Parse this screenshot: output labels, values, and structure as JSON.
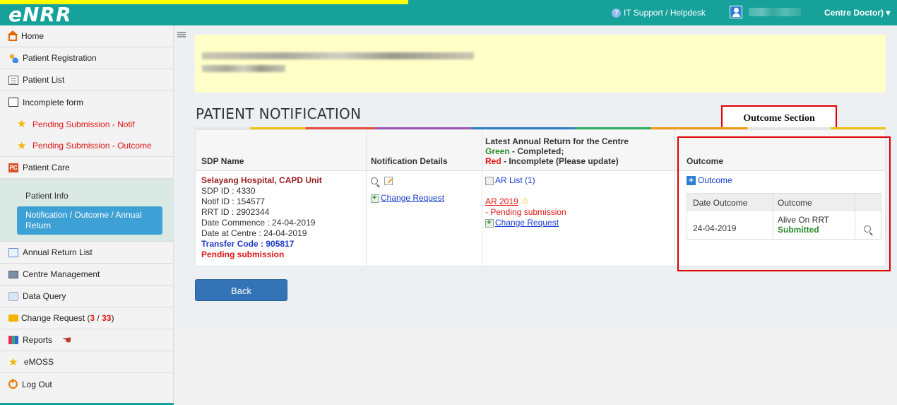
{
  "app": {
    "logo": "eNRR"
  },
  "header": {
    "helpdesk": "IT Support / Helpdesk",
    "user_role": "Centre Doctor)"
  },
  "sidebar": {
    "items": [
      {
        "label": "Home",
        "icon": "home-icon"
      },
      {
        "label": "Patient Registration",
        "icon": "people-icon"
      },
      {
        "label": "Patient List",
        "icon": "list-icon"
      },
      {
        "label": "Incomplete form",
        "icon": "form-icon"
      },
      {
        "label": "Pending Submission - Notif",
        "icon": "star-icon"
      },
      {
        "label": "Pending Submission - Outcome",
        "icon": "star-icon"
      },
      {
        "label": "Patient Care",
        "icon": "pc-icon"
      }
    ],
    "patient_care_sub": {
      "patient_info": "Patient Info",
      "active": "Notification / Outcome / Annual Return"
    },
    "items2": [
      {
        "label": "Annual Return List",
        "icon": "document-icon"
      },
      {
        "label": "Centre Management",
        "icon": "monitor-icon"
      },
      {
        "label": "Data Query",
        "icon": "query-icon"
      },
      {
        "label": "Change Request (",
        "count_a": "3",
        "sep": " / ",
        "count_b": "33",
        "close": ")",
        "icon": "mail-icon"
      },
      {
        "label": "Reports",
        "icon": "reports-icon"
      },
      {
        "label": "eMOSS",
        "icon": "star-icon"
      },
      {
        "label": "Log Out",
        "icon": "power-icon"
      }
    ]
  },
  "page": {
    "title": "PATIENT NOTIFICATION",
    "columns": {
      "sdp": "SDP Name",
      "notif": "Notification Details",
      "ar_line1": "Latest Annual Return for the Centre",
      "ar_green": "Green",
      "ar_green_rest": " - Completed;",
      "ar_red": "Red",
      "ar_red_rest": " - Incomplete (Please update)",
      "outcome": "Outcome"
    },
    "row": {
      "hospital": "Selayang Hospital, CAPD Unit",
      "sdp_id": "SDP ID : 4330",
      "notif_id": "Notif ID : 154577",
      "rrt_id": "RRT ID : 2902344",
      "date_commence": "Date Commence : 24-04-2019",
      "date_centre": "Date at Centre : 24-04-2019",
      "transfer_code": "Transfer Code : 905817",
      "status": "Pending submission",
      "change_request": "Change Request",
      "ar_list": "AR List (1)",
      "ar_year": "AR 2019",
      "ar_status": "- Pending submission",
      "ar_change_request": "Change Request",
      "outcome_add": "Outcome"
    },
    "outcome_table": {
      "headers": [
        "Date Outcome",
        "Outcome"
      ],
      "rows": [
        {
          "date": "24-04-2019",
          "outcome": "Alive On RRT",
          "status": "Submitted"
        }
      ]
    },
    "annotation": "Outcome Section",
    "back_button": "Back"
  }
}
